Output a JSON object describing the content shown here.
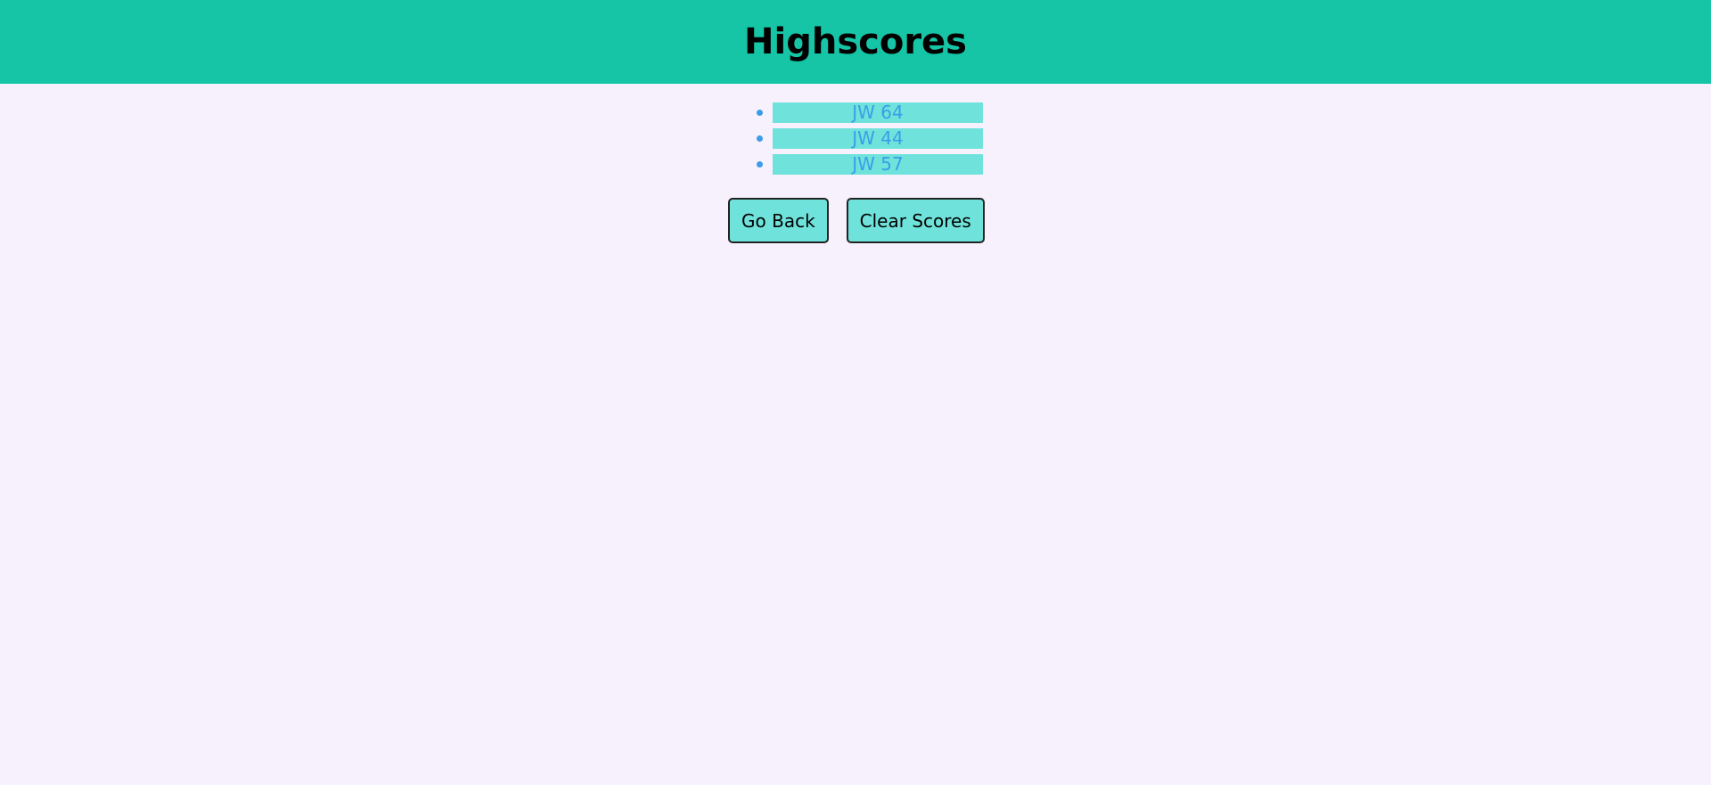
{
  "header": {
    "title": "Highscores"
  },
  "scores": [
    "JW 64",
    "JW 44",
    "JW 57"
  ],
  "buttons": {
    "go_back": "Go Back",
    "clear_scores": "Clear Scores"
  },
  "colors": {
    "header": "#15c5a5",
    "background": "#f7f1fd",
    "item_bg": "#6fe3db",
    "item_text": "#3b9de8"
  }
}
